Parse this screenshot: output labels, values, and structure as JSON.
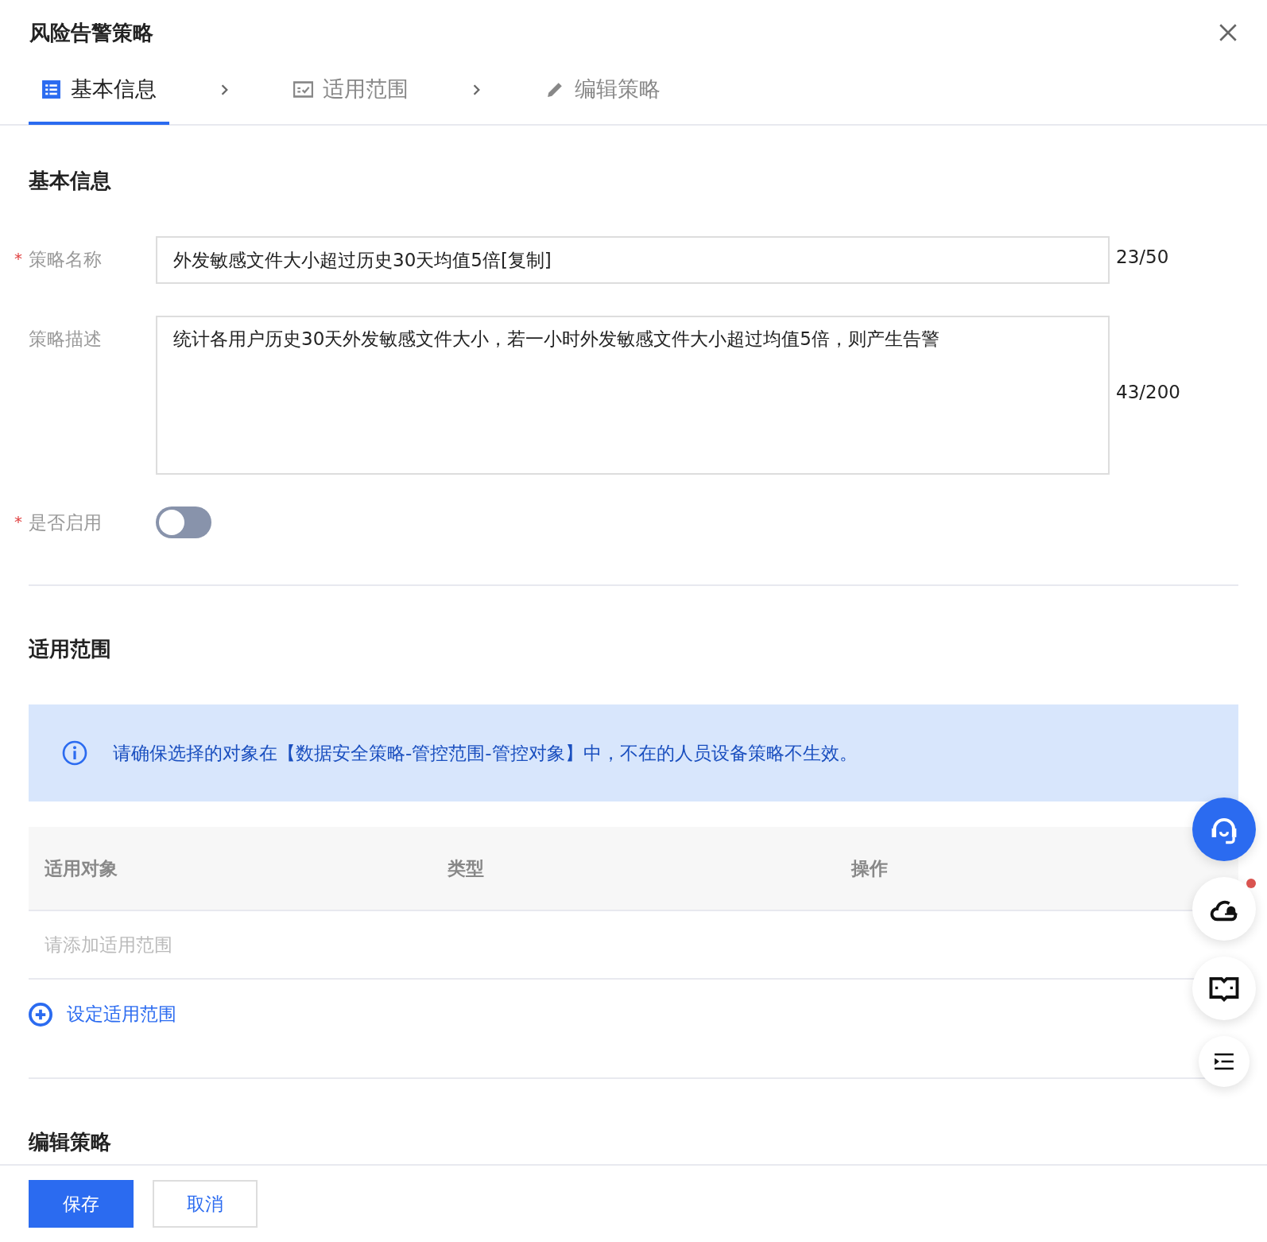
{
  "window": {
    "title": "风险告警策略"
  },
  "steps": [
    {
      "label": "基本信息",
      "kind": "form",
      "selected": true
    },
    {
      "label": "适用范围",
      "kind": "scope",
      "selected": false
    },
    {
      "label": "编辑策略",
      "kind": "edit",
      "selected": false
    }
  ],
  "basic": {
    "heading": "基本信息",
    "name": {
      "label": "策略名称",
      "mark": "*",
      "value": "外发敏感文件大小超过历史30天均值5倍[复制]",
      "count": "23/50"
    },
    "description": {
      "label": "策略描述",
      "value": "统计各用户历史30天外发敏感文件大小，若一小时外发敏感文件大小超过均值5倍，则产生告警",
      "count": "43/200"
    },
    "enabled": {
      "label": "是否启用",
      "mark": "*",
      "on": false
    }
  },
  "scope": {
    "heading": "适用范围",
    "notice": "请确保选择的对象在【数据安全策略-管控范围-管控对象】中，不在的人员设备策略不生效。",
    "table": {
      "columns": [
        "适用对象",
        "类型",
        "操作"
      ],
      "empty_text": "请添加适用范围"
    },
    "add_link": "设定适用范围"
  },
  "edit": {
    "heading": "编辑策略"
  },
  "floating": [
    {
      "kind": "support"
    },
    {
      "kind": "alert"
    },
    {
      "kind": "docs"
    },
    {
      "kind": "outline"
    }
  ],
  "footer": {
    "buttons": [
      {
        "label": "保存",
        "primary": true
      },
      {
        "label": "取消",
        "primary": false
      }
    ]
  }
}
